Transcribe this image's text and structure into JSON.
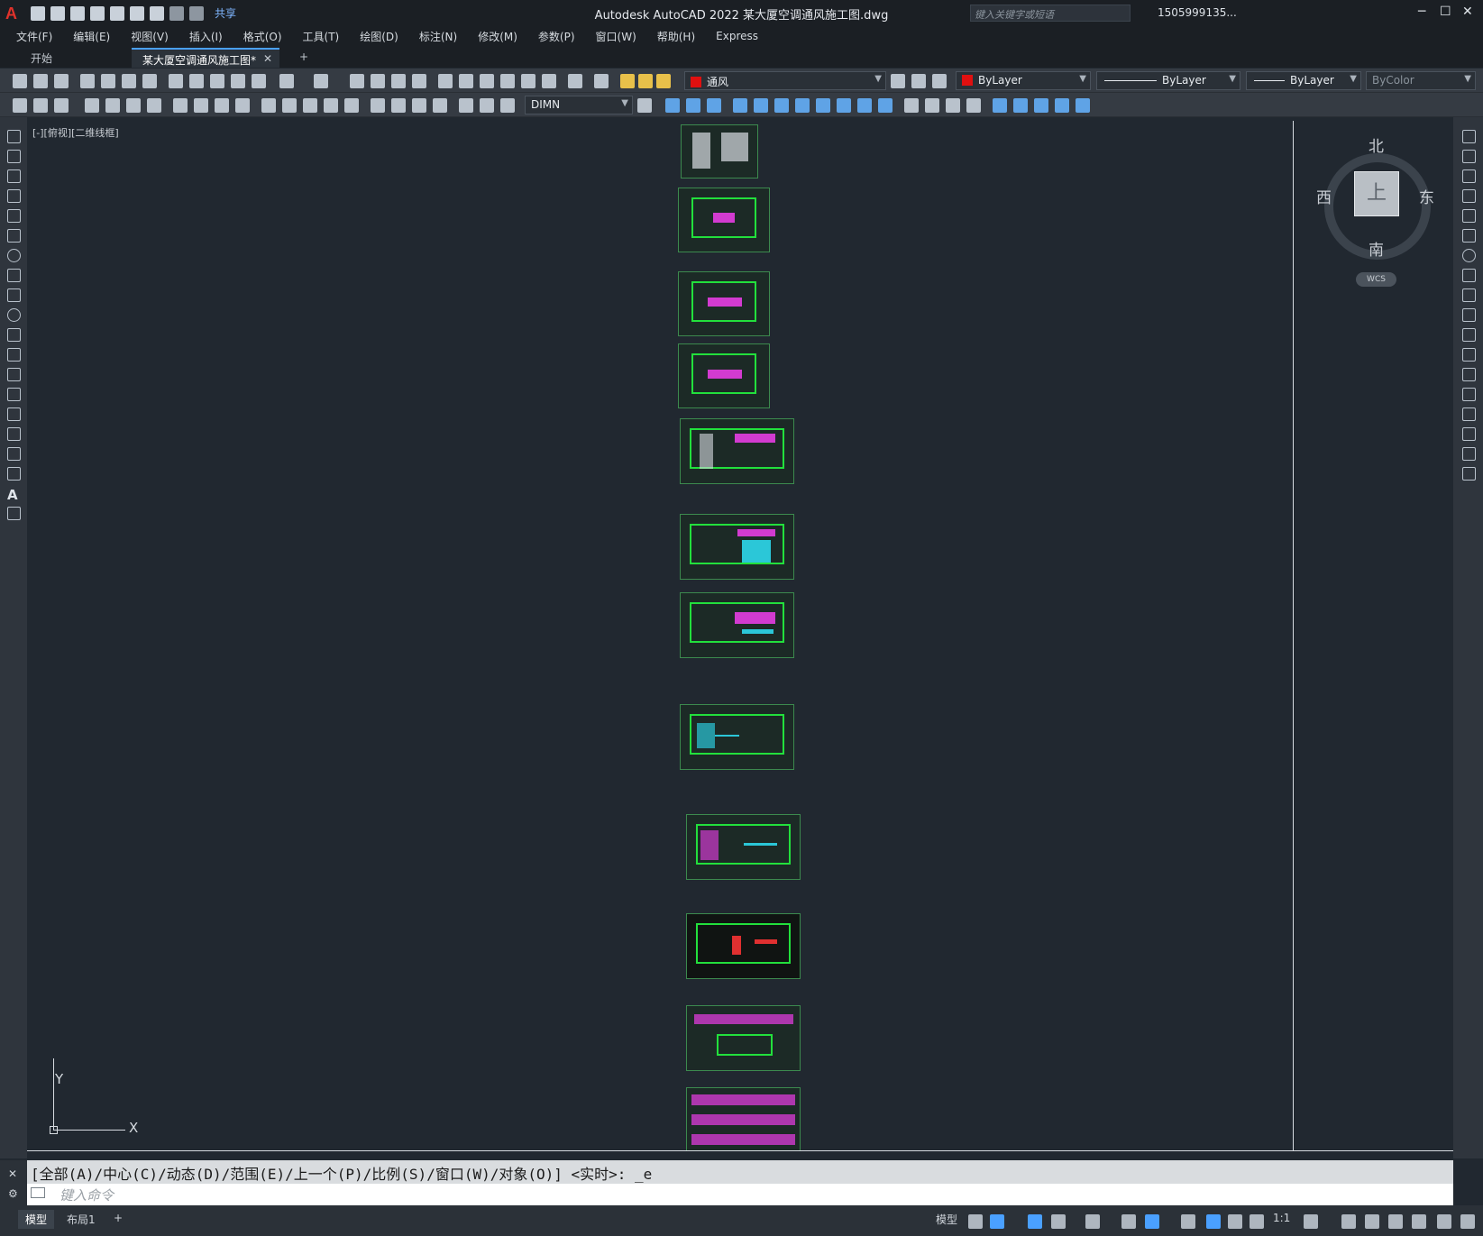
{
  "titlebar": {
    "app_title": "Autodesk AutoCAD 2022    某大厦空调通风施工图.dwg",
    "share_label": "共享",
    "search_placeholder": "键入关键字或短语",
    "user_name": "1505999135...",
    "minimize": "─",
    "maximize": "☐",
    "close": "✕"
  },
  "menu": [
    "文件(F)",
    "编辑(E)",
    "视图(V)",
    "插入(I)",
    "格式(O)",
    "工具(T)",
    "绘图(D)",
    "标注(N)",
    "修改(M)",
    "参数(P)",
    "窗口(W)",
    "帮助(H)",
    "Express"
  ],
  "tabs": {
    "start": "开始",
    "drawing": "某大厦空调通风施工图*",
    "close": "✕",
    "add": "+"
  },
  "toolbar": {
    "layer_name": "通风",
    "color": "ByLayer",
    "linetype": "ByLayer",
    "lineweight": "ByLayer",
    "plotstyle": "ByColor",
    "dimstyle": "DIMN",
    "layer_color": "#e01010"
  },
  "viewport": {
    "label": "[-][俯视][二维线框]"
  },
  "viewcube": {
    "north": "北",
    "south": "南",
    "east": "东",
    "west": "西",
    "top": "上",
    "wcs": "WCS"
  },
  "ucs": {
    "x": "X",
    "y": "Y"
  },
  "command": {
    "history": "[全部(A)/中心(C)/动态(D)/范围(E)/上一个(P)/比例(S)/窗口(W)/对象(O)] <实时>: _e",
    "placeholder": "键入命令"
  },
  "status": {
    "model_tab": "模型",
    "layout_tab": "布局1",
    "add_tab": "+",
    "model_label": "模型",
    "scale": "1:1"
  },
  "colors": {
    "canvas": "#212830",
    "drawing_green": "#22e03c",
    "accent": "#4aa0ff"
  }
}
